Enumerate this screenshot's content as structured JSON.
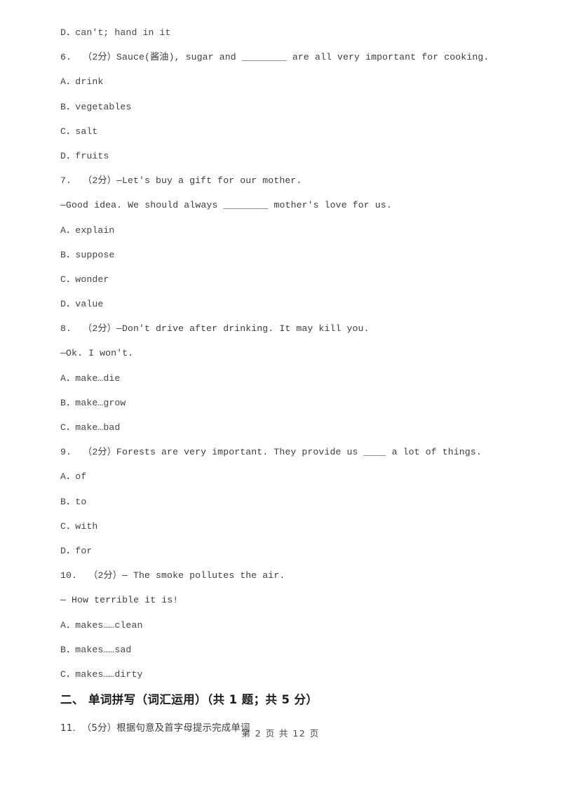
{
  "document": {
    "type": "scanned-exam-paper",
    "page_number": 2,
    "total_pages": 12,
    "footer": "第 2 页 共 12 页"
  },
  "body_lines": [
    {
      "kind": "option",
      "text": "D．can't; hand in it"
    },
    {
      "kind": "stem",
      "text": "6.  （2分）Sauce(酱油), sugar and ________ are all very important for cooking."
    },
    {
      "kind": "option",
      "text": "A．drink"
    },
    {
      "kind": "option",
      "text": "B．vegetables"
    },
    {
      "kind": "option",
      "text": "C．salt"
    },
    {
      "kind": "option",
      "text": "D．fruits"
    },
    {
      "kind": "stem",
      "text": "7.  （2分）—Let's buy a gift for our mother."
    },
    {
      "kind": "stem",
      "text": "—Good idea. We should always ________ mother's love for us."
    },
    {
      "kind": "option",
      "text": "A．explain"
    },
    {
      "kind": "option",
      "text": "B．suppose"
    },
    {
      "kind": "option",
      "text": "C．wonder"
    },
    {
      "kind": "option",
      "text": "D．value"
    },
    {
      "kind": "stem",
      "text": "8.  （2分）—Don't drive after drinking. It may kill you."
    },
    {
      "kind": "stem",
      "text": "—Ok. I won't."
    },
    {
      "kind": "option",
      "text": "A．make…die"
    },
    {
      "kind": "option",
      "text": "B．make…grow"
    },
    {
      "kind": "option",
      "text": "C．make…bad"
    },
    {
      "kind": "stem",
      "text": "9.  （2分）Forests are very important. They provide us ____ a lot of things."
    },
    {
      "kind": "option",
      "text": "A．of"
    },
    {
      "kind": "option",
      "text": "B．to"
    },
    {
      "kind": "option",
      "text": "C．with"
    },
    {
      "kind": "option",
      "text": "D．for"
    },
    {
      "kind": "stem",
      "text": "10.  （2分）— The smoke pollutes the air."
    },
    {
      "kind": "stem",
      "text": "— How terrible it is!"
    },
    {
      "kind": "option",
      "text": "A．makes……clean"
    },
    {
      "kind": "option",
      "text": "B．makes……sad"
    },
    {
      "kind": "option",
      "text": "C．makes……dirty"
    },
    {
      "kind": "heading",
      "text": "二、 单词拼写（词汇运用）（共 1 题；共 5 分）"
    },
    {
      "kind": "cjk",
      "text": "11.  （5分）根据句意及首字母提示完成单词"
    }
  ]
}
